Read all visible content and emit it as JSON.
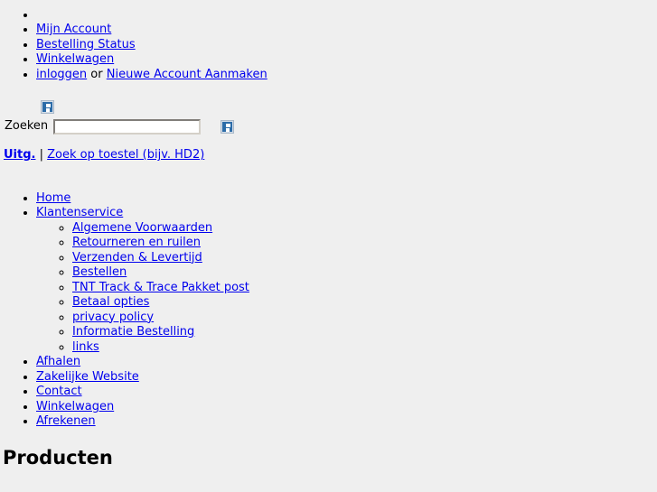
{
  "account_nav": {
    "items": [
      {
        "label": "",
        "empty": true
      },
      {
        "label": "Mijn Account",
        "empty": false
      },
      {
        "label": "Bestelling Status",
        "empty": false
      },
      {
        "label": "Winkelwagen",
        "empty": false
      }
    ],
    "login_item": {
      "login_label": "inloggen",
      "separator": " or ",
      "register_label": "Nieuwe Account Aanmaken"
    }
  },
  "header": {
    "logo_alt": "broken-image-icon",
    "search_label": "Zoeken",
    "search_value": "",
    "search_placeholder": "",
    "search_button_alt": "broken-image-icon"
  },
  "secondary_links": {
    "publisher_label": "Uitg.",
    "separator": " | ",
    "device_search_label": "Zoek op toestel (bijv. HD2)"
  },
  "main_nav": {
    "items": [
      {
        "label": "Home"
      },
      {
        "label": "Klantenservice",
        "children": [
          {
            "label": "Algemene Voorwaarden"
          },
          {
            "label": "Retourneren en ruilen"
          },
          {
            "label": "Verzenden & Levertijd"
          },
          {
            "label": "Bestellen"
          },
          {
            "label": "TNT Track & Trace Pakket post"
          },
          {
            "label": "Betaal opties"
          },
          {
            "label": "privacy policy"
          },
          {
            "label": "Informatie Bestelling"
          },
          {
            "label": "links"
          }
        ]
      },
      {
        "label": "Afhalen"
      },
      {
        "label": "Zakelijke Website"
      },
      {
        "label": "Contact"
      },
      {
        "label": "Winkelwagen"
      },
      {
        "label": "Afrekenen"
      }
    ]
  },
  "content": {
    "products_heading": "Producten"
  },
  "colors": {
    "page_background": "#efefef",
    "link": "#0000ee",
    "text": "#000000",
    "input_background": "#ffffff"
  }
}
